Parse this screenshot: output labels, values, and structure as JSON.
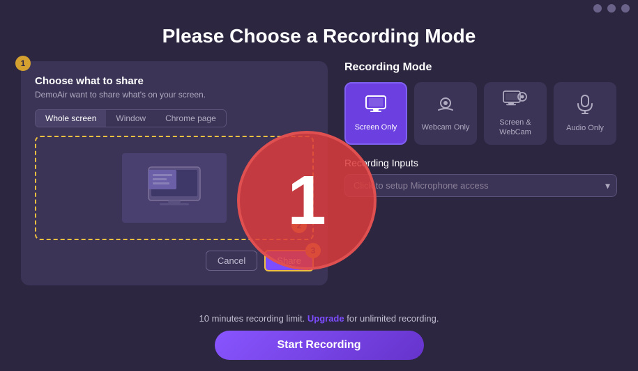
{
  "page": {
    "title": "Please Choose a Recording Mode",
    "background": "#2d2640"
  },
  "screen_share_dialog": {
    "title": "Choose what to share",
    "subtitle": "DemoAir want to share what's on your screen.",
    "tabs": [
      {
        "label": "Whole screen",
        "active": true
      },
      {
        "label": "Window",
        "active": false
      },
      {
        "label": "Chrome page",
        "active": false
      }
    ],
    "cancel_label": "Cancel",
    "share_label": "Share"
  },
  "recording_mode": {
    "section_label": "Recording Mode",
    "modes": [
      {
        "id": "screen-only",
        "label": "Screen Only",
        "icon": "🖥",
        "active": true
      },
      {
        "id": "webcam-only",
        "label": "Webcam Only",
        "icon": "📷",
        "active": false
      },
      {
        "id": "screen-webcam",
        "label": "Screen &\nWebCam",
        "icon": "🎬",
        "active": false
      },
      {
        "id": "audio-only",
        "label": "Audio Only",
        "icon": "🎙",
        "active": false
      }
    ]
  },
  "audio_inputs": {
    "label": "Recording Inputs",
    "placeholder": "Click to setup Microphone access"
  },
  "bottom": {
    "limit_text": "10 minutes recording limit.",
    "upgrade_label": "Upgrade",
    "upgrade_suffix": " for unlimited recording.",
    "start_label": "Start Recording"
  },
  "steps": {
    "step1": "1",
    "step2": "2",
    "step3": "3"
  },
  "big_step": "1"
}
